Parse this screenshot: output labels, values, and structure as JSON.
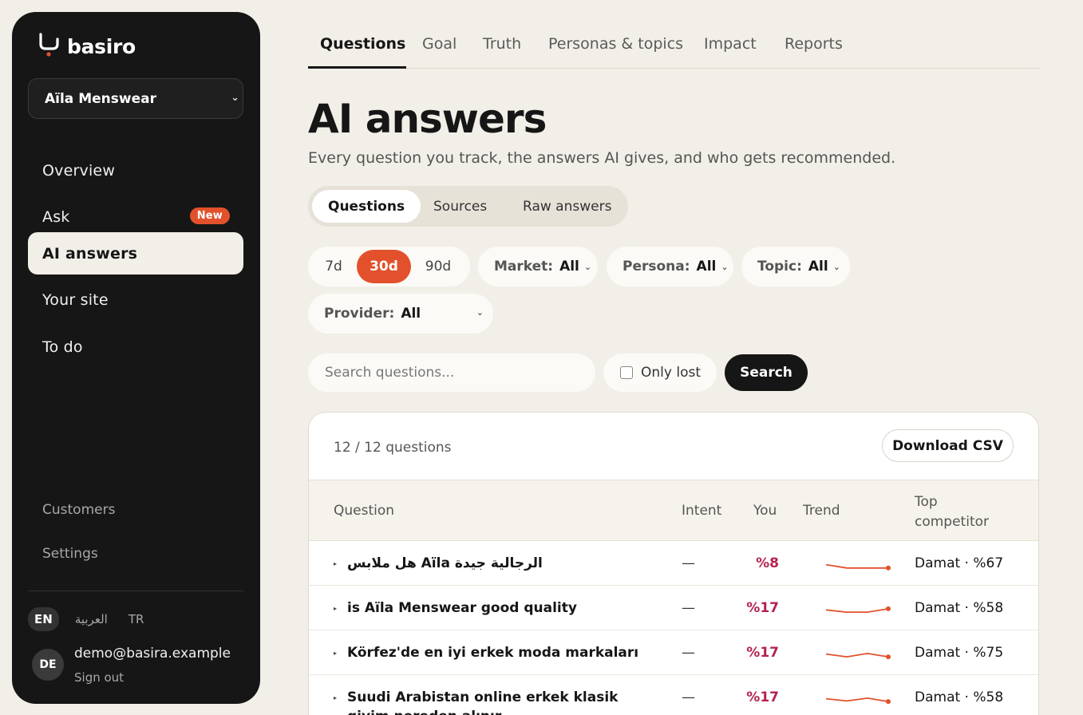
{
  "sidebar": {
    "logo_text": "basiro",
    "brand_select": "Aïla Menswear",
    "nav": [
      {
        "label": "Overview"
      },
      {
        "label": "Ask",
        "badge": "New"
      },
      {
        "label": "AI answers"
      },
      {
        "label": "Your site"
      },
      {
        "label": "To do"
      }
    ],
    "secondary": [
      {
        "label": "Customers"
      },
      {
        "label": "Settings"
      }
    ],
    "languages": [
      "EN",
      "العربية",
      "TR"
    ],
    "user": {
      "initials": "DE",
      "email": "demo@basira.example",
      "signout": "Sign out"
    }
  },
  "tabs": [
    "Questions",
    "Goal",
    "Truth",
    "Personas & topics",
    "Impact",
    "Reports"
  ],
  "page": {
    "title": "AI answers",
    "subtitle": "Every question you track, the answers AI gives, and who gets recommended."
  },
  "segments": [
    "Questions",
    "Sources",
    "Raw answers"
  ],
  "ranges": [
    "7d",
    "30d",
    "90d"
  ],
  "filters": {
    "market": {
      "label": "Market:",
      "value": "All"
    },
    "persona": {
      "label": "Persona:",
      "value": "All"
    },
    "topic": {
      "label": "Topic:",
      "value": "All"
    },
    "provider": {
      "label": "Provider:",
      "value": "All"
    }
  },
  "search": {
    "placeholder": "Search questions...",
    "only_lost": "Only lost",
    "button": "Search"
  },
  "table": {
    "count": "12 / 12 questions",
    "download": "Download CSV",
    "headers": {
      "question": "Question",
      "intent": "Intent",
      "you": "You",
      "trend": "Trend",
      "competitor": "Top competitor"
    },
    "rows": [
      {
        "question": "هل ملابس Aïla الرجالية جيدة",
        "intent": "—",
        "you": "%8",
        "competitor": "Damat · %67",
        "trend": [
          0.6,
          0.3,
          0.3,
          0.3
        ]
      },
      {
        "question": "is Aïla Menswear good quality",
        "intent": "—",
        "you": "%17",
        "competitor": "Damat · %58",
        "trend": [
          0.55,
          0.35,
          0.35,
          0.65
        ]
      },
      {
        "question": "Körfez'de en iyi erkek moda markaları",
        "intent": "—",
        "you": "%17",
        "competitor": "Damat · %75",
        "trend": [
          0.6,
          0.35,
          0.65,
          0.35
        ]
      },
      {
        "question": "Suudi Arabistan online erkek klasik giyim nereden alınır",
        "intent": "—",
        "you": "%17",
        "competitor": "Damat · %58",
        "trend": [
          0.6,
          0.4,
          0.65,
          0.35
        ]
      }
    ]
  },
  "colors": {
    "accent": "#e2512b",
    "sidebar": "#161616",
    "background": "#f2efe8",
    "share": "#b3234f"
  }
}
